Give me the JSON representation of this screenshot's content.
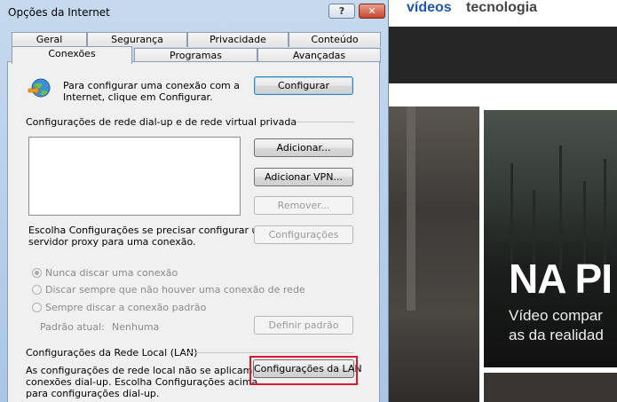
{
  "background_page": {
    "nav": [
      "vídeos",
      "tecnologia"
    ],
    "headline": "NA PI",
    "subline_1": "Vídeo compar",
    "subline_2": "as da realidad"
  },
  "dialog": {
    "title": "Opções da Internet",
    "help_label": "?",
    "close_label": "✕",
    "tabs_row1": [
      "Geral",
      "Segurança",
      "Privacidade",
      "Conteúdo"
    ],
    "tabs_row2": [
      "Conexões",
      "Programas",
      "Avançadas"
    ],
    "active_tab": "Conexões",
    "setup": {
      "text_1": "Para configurar uma conexão com a",
      "text_2": "Internet, clique em Configurar.",
      "button": "Configurar"
    },
    "dialup": {
      "heading": "Configurações de rede dial-up e de rede virtual privada",
      "add": "Adicionar...",
      "add_vpn": "Adicionar VPN...",
      "remove": "Remover...",
      "settings": "Configurações",
      "hint_1": "Escolha Configurações se precisar configurar um",
      "hint_2": "servidor proxy para uma conexão.",
      "options": [
        "Nunca discar uma conexão",
        "Discar sempre que não houver uma conexão de rede",
        "Sempre discar a conexão padrão"
      ],
      "selected_option": "Nunca discar uma conexão",
      "default_label": "Padrão atual:",
      "default_value": "Nenhuma",
      "set_default": "Definir padrão"
    },
    "lan": {
      "heading": "Configurações da Rede Local (LAN)",
      "text_1": "As configurações de rede local não se aplicam a",
      "text_2": "conexões dial-up. Escolha Configurações acima",
      "text_3": "para configurações dial-up.",
      "button": "Configurações da LAN"
    },
    "colors": {
      "highlight": "#d8192f",
      "title_bar": "#c6d9ee"
    }
  }
}
